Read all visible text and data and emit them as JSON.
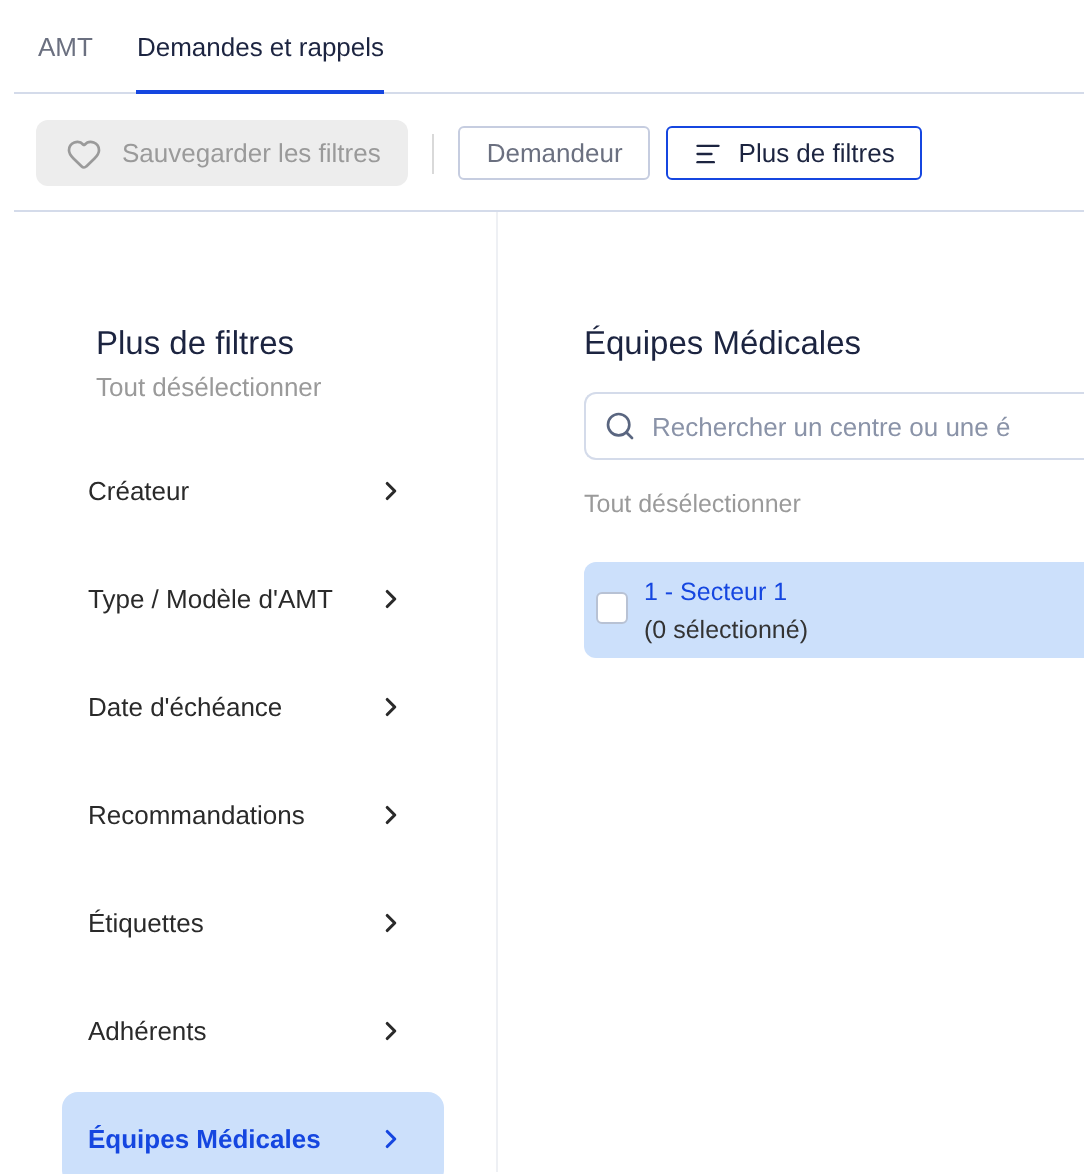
{
  "tabs": [
    {
      "label": "AMT",
      "selected": false
    },
    {
      "label": "Demandes et rappels",
      "selected": true
    }
  ],
  "toolbar": {
    "save_button": {
      "label": "Sauvegarder les filtres",
      "disabled": true
    },
    "filter_buttons": [
      {
        "label": "Demandeur",
        "selected": false,
        "kind": "plain"
      },
      {
        "label": "Plus de filtres",
        "selected": true,
        "kind": "menu"
      }
    ]
  },
  "sidebar": {
    "title": "Plus de filtres",
    "deselect_all": "Tout désélectionner",
    "items": [
      {
        "label": "Créateur",
        "selected": false
      },
      {
        "label": "Type / Modèle d'AMT",
        "selected": false
      },
      {
        "label": "Date d'échéance",
        "selected": false
      },
      {
        "label": "Recommandations",
        "selected": false
      },
      {
        "label": "Étiquettes",
        "selected": false
      },
      {
        "label": "Adhérents",
        "selected": false
      },
      {
        "label": "Équipes Médicales",
        "selected": true
      }
    ]
  },
  "panel": {
    "title": "Équipes Médicales",
    "search": {
      "placeholder": "Rechercher un centre ou une é"
    },
    "deselect_all": "Tout désélectionner",
    "options": [
      {
        "label": "1 - Secteur 1",
        "count": "(0 sélectionné)",
        "checked": false
      }
    ]
  }
}
